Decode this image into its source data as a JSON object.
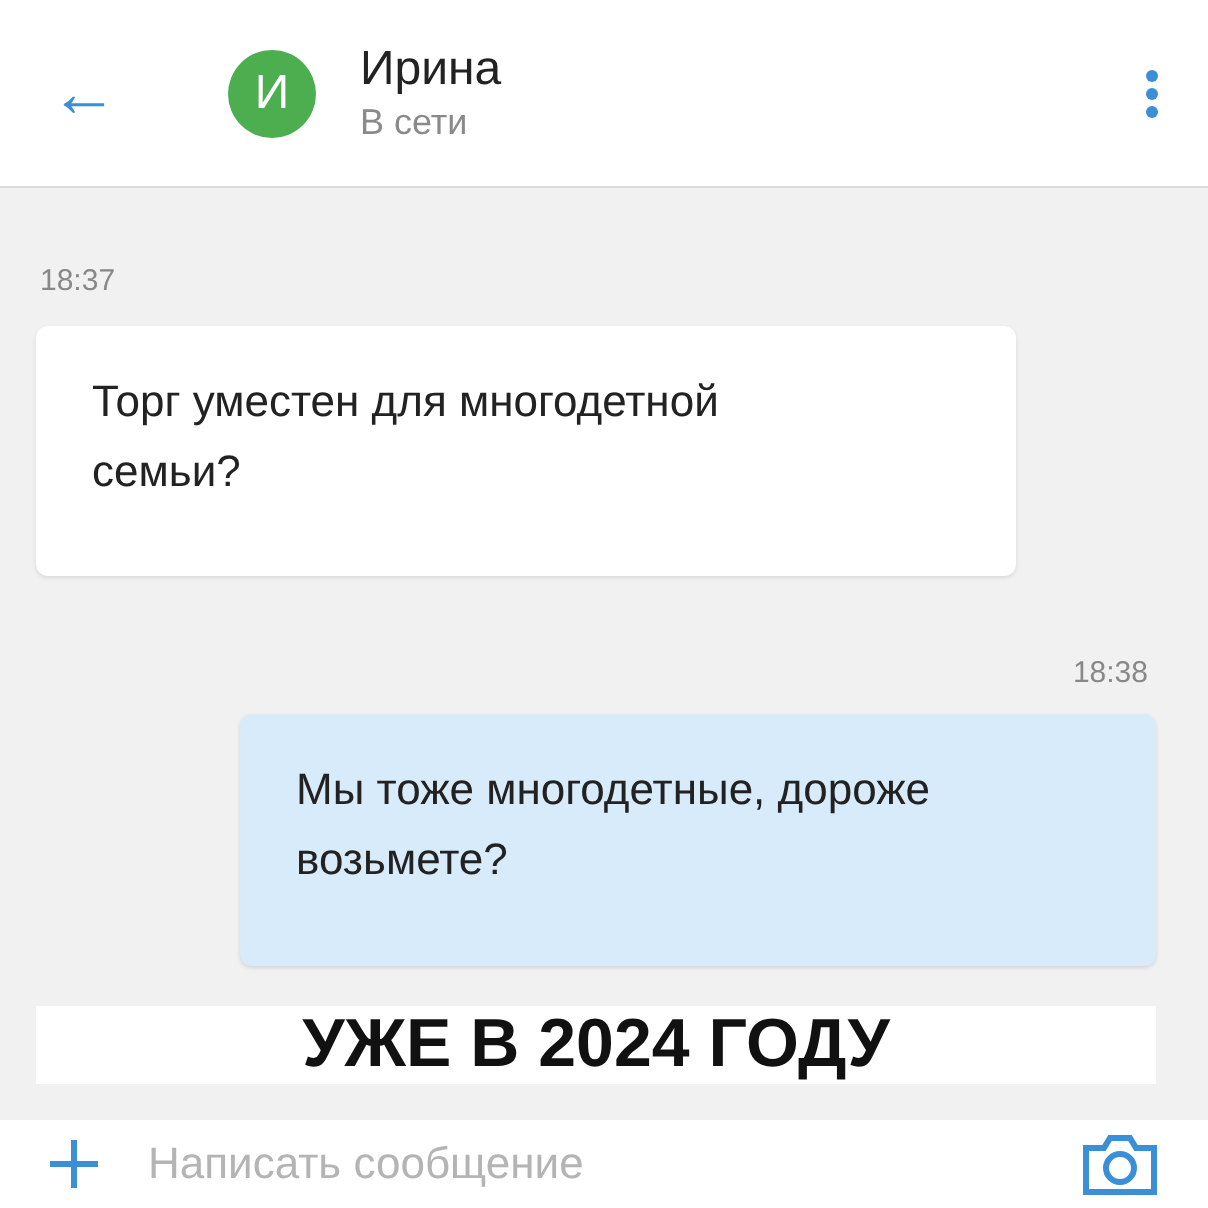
{
  "header": {
    "back": "←",
    "avatar_letter": "И",
    "name": "Ирина",
    "status": "В сети"
  },
  "messages": [
    {
      "kind": "incoming",
      "time": "18:37",
      "text": "Торг уместен для многодетной семьи?"
    },
    {
      "kind": "outgoing",
      "time": "18:38",
      "text": "Мы тоже многодетные, дороже возьмете?"
    }
  ],
  "caption": "УЖЕ В 2024 ГОДУ",
  "composer": {
    "placeholder": "Написать сообщение"
  }
}
